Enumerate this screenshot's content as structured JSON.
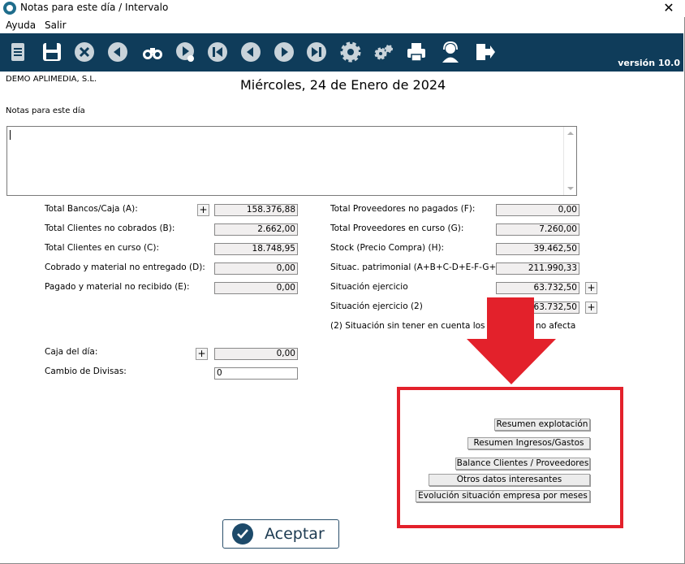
{
  "window": {
    "title": "Notas para este día / Intervalo",
    "close_glyph": "✕"
  },
  "menu": [
    "Ayuda",
    "Salir"
  ],
  "toolbar": {
    "icons": [
      "document-icon",
      "save-icon",
      "cancel-icon",
      "back-icon",
      "binoculars-icon",
      "forward-search-icon",
      "first-icon",
      "previous-icon",
      "next-icon",
      "last-icon",
      "settings-icon",
      "gears-icon",
      "print-icon",
      "support-icon",
      "exit-icon"
    ],
    "version": "versión 10.0"
  },
  "company": "DEMO APLIMEDIA, S.L.",
  "date": "Miércoles, 24 de Enero de 2024",
  "notes": {
    "label": "Notas para este día",
    "value": ""
  },
  "left_totals": [
    {
      "label": "Total Bancos/Caja (A):",
      "value": "158.376,88",
      "plus": "+"
    },
    {
      "label": "Total Clientes no cobrados (B):",
      "value": "2.662,00"
    },
    {
      "label": "Total Clientes en curso (C):",
      "value": "18.748,95"
    },
    {
      "label": "Cobrado y material no entregado (D):",
      "value": "0,00"
    },
    {
      "label": "Pagado y material no recibido (E):",
      "value": "0,00"
    }
  ],
  "right_totals": [
    {
      "label": "Total Proveedores no pagados (F):",
      "value": "0,00"
    },
    {
      "label": "Total Proveedores  en curso (G):",
      "value": "7.260,00"
    },
    {
      "label": "Stock (Precio Compra) (H):",
      "value": "39.462,50"
    },
    {
      "label": "Situac. patrimonial (A+B+C-D+E-F-G+H)",
      "value": "211.990,33"
    },
    {
      "label": "Situación ejercicio",
      "value": "63.732,50",
      "plus": "+"
    },
    {
      "label": "Situación ejercicio (2)",
      "value": "63.732,50",
      "plus": "+"
    }
  ],
  "footnote": "(2) Situación sin tener en cuenta los marc",
  "footnote_end": "no afecta",
  "caja": {
    "label": "Caja del día:",
    "value": "0,00",
    "plus": "+"
  },
  "divisas": {
    "label": "Cambio de Divisas:",
    "value": "0"
  },
  "report_buttons": [
    "Resumen explotación",
    "Resumen Ingresos/Gastos",
    "Balance Clientes / Proveedores",
    "Otros datos interesantes",
    "Evolución situación empresa por meses"
  ],
  "accept_label": "Aceptar",
  "colors": {
    "toolbar_bg": "#0f3c5a",
    "highlight_red": "#e3212b",
    "accent": "#1d4a6a"
  }
}
